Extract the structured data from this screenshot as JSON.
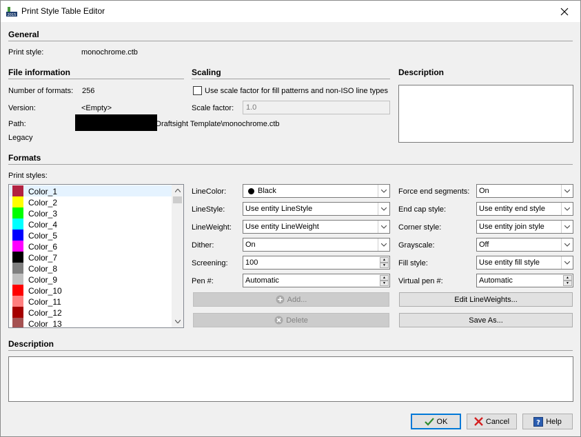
{
  "window": {
    "title": "Print Style Table Editor",
    "app_icon_text": "2015"
  },
  "general": {
    "title": "General",
    "print_style_label": "Print style:",
    "print_style_value": "monochrome.ctb"
  },
  "file_info": {
    "title": "File information",
    "num_formats_label": "Number of formats:",
    "num_formats_value": "256",
    "version_label": "Version:",
    "version_value": "<Empty>",
    "path_label": "Path:",
    "path_value": "Draftsight Template\\monochrome.ctb",
    "legacy_label": "Legacy"
  },
  "scaling": {
    "title": "Scaling",
    "use_scale_label": "Use scale factor for fill patterns and non-ISO line types",
    "use_scale_checked": false,
    "scale_factor_label": "Scale factor:",
    "scale_factor_value": "1.0"
  },
  "description_top": {
    "title": "Description",
    "value": ""
  },
  "formats": {
    "title": "Formats",
    "print_styles_label": "Print styles:",
    "styles": [
      {
        "name": "Color_1",
        "color": "#b22241"
      },
      {
        "name": "Color_2",
        "color": "#ffff00"
      },
      {
        "name": "Color_3",
        "color": "#00ff00"
      },
      {
        "name": "Color_4",
        "color": "#00ffff"
      },
      {
        "name": "Color_5",
        "color": "#0000ff"
      },
      {
        "name": "Color_6",
        "color": "#ff00ff"
      },
      {
        "name": "Color_7",
        "color": "#000000"
      },
      {
        "name": "Color_8",
        "color": "#808080"
      },
      {
        "name": "Color_9",
        "color": "#c0c0c0"
      },
      {
        "name": "Color_10",
        "color": "#ff0000"
      },
      {
        "name": "Color_11",
        "color": "#ff7f7f"
      },
      {
        "name": "Color_12",
        "color": "#a50000"
      },
      {
        "name": "Color_13",
        "color": "#a55252"
      }
    ],
    "selected_style": "Color_1",
    "linecolor_label": "LineColor:",
    "linecolor_value": "Black",
    "linestyle_label": "LineStyle:",
    "linestyle_value": "Use entity LineStyle",
    "lineweight_label": "LineWeight:",
    "lineweight_value": "Use entity LineWeight",
    "dither_label": "Dither:",
    "dither_value": "On",
    "screening_label": "Screening:",
    "screening_value": "100",
    "pen_label": "Pen #:",
    "pen_value": "Automatic",
    "add_label": "Add...",
    "delete_label": "Delete",
    "force_end_label": "Force end segments:",
    "force_end_value": "On",
    "end_cap_label": "End cap style:",
    "end_cap_value": "Use entity end style",
    "corner_label": "Corner style:",
    "corner_value": "Use entity join style",
    "grayscale_label": "Grayscale:",
    "grayscale_value": "Off",
    "fill_label": "Fill style:",
    "fill_value": "Use entity fill style",
    "virtual_pen_label": "Virtual pen #:",
    "virtual_pen_value": "Automatic",
    "edit_lineweights_label": "Edit LineWeights...",
    "save_as_label": "Save As..."
  },
  "description_bottom": {
    "title": "Description",
    "value": ""
  },
  "footer": {
    "ok_label": "OK",
    "cancel_label": "Cancel",
    "help_label": "Help"
  }
}
